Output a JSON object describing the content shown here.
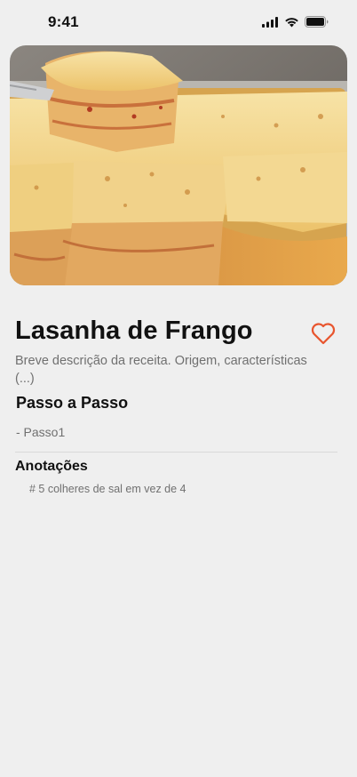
{
  "status_bar": {
    "time": "9:41",
    "icons": [
      "cellular-signal-icon",
      "wifi-icon",
      "battery-icon"
    ]
  },
  "hero_image": {
    "subject": "lasanha-de-frango-photo"
  },
  "recipe": {
    "title": "Lasanha de Frango",
    "description": "Breve descrição da receita. Origem, características (...)",
    "favorite_icon": "heart-outline-icon"
  },
  "steps": {
    "heading": "Passo a Passo",
    "items": [
      "- Passo1"
    ]
  },
  "notes": {
    "heading": "Anotações",
    "items": [
      "# 5 colheres de sal em vez de 4"
    ]
  },
  "colors": {
    "background": "#efefef",
    "accent": "#e8552e",
    "muted_text": "#707070"
  }
}
